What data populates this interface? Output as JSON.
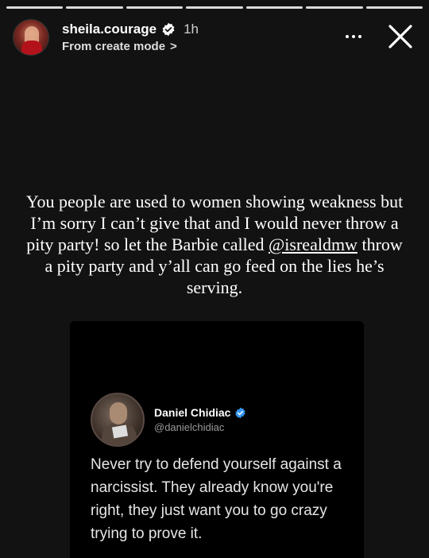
{
  "story": {
    "segments": 7,
    "username": "sheila.courage",
    "time_ago": "1h",
    "subtitle": "From create mode",
    "subtitle_chevron": ">"
  },
  "icons": {
    "verified": "verified-badge-icon",
    "more": "more-options-icon",
    "close": "close-icon"
  },
  "caption": {
    "before": "You people are used to women showing weakness but I’m sorry I can’t give that and I would never throw a pity party! so let the Barbie called ",
    "mention": "@isrealdmw",
    "after": " throw a pity party and y’all can go feed on the lies he’s serving."
  },
  "tweet": {
    "name": "Daniel Chidiac",
    "handle": "@danielchidiac",
    "text": "Never try to defend yourself against a narcissist. They already know you're right, they just want you to go crazy trying to prove it."
  },
  "colors": {
    "background": "#121212",
    "verified_blue": "#3897f0"
  }
}
